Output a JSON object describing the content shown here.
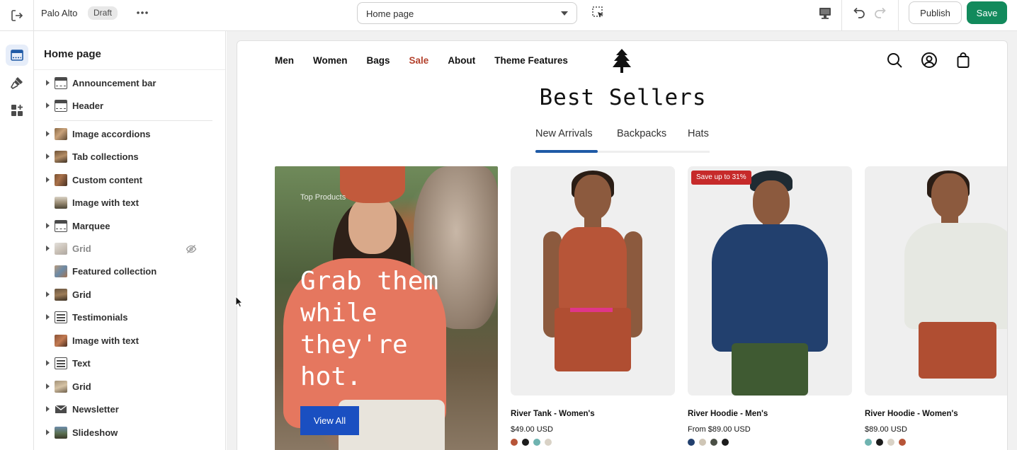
{
  "topbar": {
    "store_name": "Palo Alto",
    "status_badge": "Draft",
    "page_selector": "Home page",
    "publish_label": "Publish",
    "save_label": "Save"
  },
  "sidebar": {
    "title": "Home page",
    "sections": [
      {
        "label": "Announcement bar",
        "icon": "section-bar-icon",
        "expandable": true
      },
      {
        "label": "Header",
        "icon": "section-bar-icon",
        "expandable": true
      },
      {
        "label": "Image accordions",
        "icon": "image-thumbnail",
        "expandable": true
      },
      {
        "label": "Tab collections",
        "icon": "image-thumbnail",
        "expandable": true
      },
      {
        "label": "Custom content",
        "icon": "image-thumbnail",
        "expandable": true
      },
      {
        "label": "Image with text",
        "icon": "image-thumbnail",
        "expandable": false
      },
      {
        "label": "Marquee",
        "icon": "section-bar-icon",
        "expandable": true
      },
      {
        "label": "Grid",
        "icon": "image-thumbnail",
        "expandable": true,
        "hidden": true
      },
      {
        "label": "Featured collection",
        "icon": "image-thumbnail",
        "expandable": false
      },
      {
        "label": "Grid",
        "icon": "image-thumbnail",
        "expandable": true
      },
      {
        "label": "Testimonials",
        "icon": "text-block-icon",
        "expandable": true
      },
      {
        "label": "Image with text",
        "icon": "image-thumbnail",
        "expandable": false
      },
      {
        "label": "Text",
        "icon": "text-block-icon",
        "expandable": true
      },
      {
        "label": "Grid",
        "icon": "image-thumbnail",
        "expandable": true
      },
      {
        "label": "Newsletter",
        "icon": "envelope-icon",
        "expandable": true
      },
      {
        "label": "Slideshow",
        "icon": "image-thumbnail",
        "expandable": true
      }
    ]
  },
  "preview": {
    "nav": [
      "Men",
      "Women",
      "Bags",
      "Sale",
      "About",
      "Theme Features"
    ],
    "sale_color": "#b3412c",
    "heading": "Best Sellers",
    "tabs": [
      "New Arrivals",
      "Backpacks",
      "Hats"
    ],
    "active_tab": "New Arrivals",
    "promo": {
      "eyebrow": "Top Products",
      "headline": "Grab them while they're hot.",
      "button": "View All"
    },
    "products": [
      {
        "name": "River Tank - Women's",
        "price": "$49.00 USD",
        "badge": "",
        "swatches": [
          "#b75538",
          "#1c1c1c",
          "#6fb3b0",
          "#d9d2c6"
        ]
      },
      {
        "name": "River Hoodie - Men's",
        "price": "From $89.00 USD",
        "badge": "Save up to 31%",
        "swatches": [
          "#22406e",
          "#cfc6b6",
          "#4a4f45",
          "#1c1c1c"
        ]
      },
      {
        "name": "River Hoodie - Women's",
        "price": "$89.00 USD",
        "badge": "",
        "swatches": [
          "#6fb3b0",
          "#1c1c1c",
          "#d9d2c6",
          "#b75538"
        ]
      }
    ]
  },
  "colors": {
    "save_green": "#128a5c",
    "accent_blue": "#1f5aa6",
    "badge_red": "#c62a2a"
  }
}
